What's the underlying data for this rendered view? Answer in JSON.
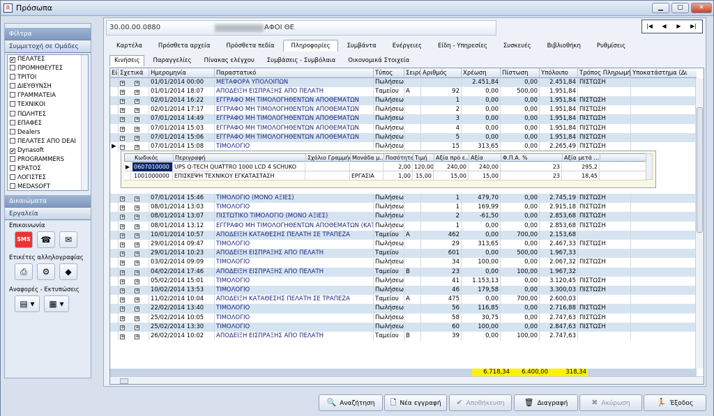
{
  "window": {
    "title": "Πρόσωπα",
    "icon": "app-icon"
  },
  "left": {
    "filters_label": "Φίλτρα",
    "groups_label": "Συμμετοχή σε Ομάδες",
    "groups": [
      {
        "label": "ΠΕΛΑΤΕΣ",
        "checked": true
      },
      {
        "label": "ΠΡΟΜΗΘΕΥΤΕΣ",
        "checked": false
      },
      {
        "label": "ΤΡΙΤΟΙ",
        "checked": false
      },
      {
        "label": "ΔΙΕΥΘΥΝΣΗ",
        "checked": false
      },
      {
        "label": "ΓΡΑΜΜΑΤΕΙΑ",
        "checked": false
      },
      {
        "label": "ΤΕΧΝΙΚΟΙ",
        "checked": false
      },
      {
        "label": "ΠΩΛΗΤΕΣ",
        "checked": false
      },
      {
        "label": "ΕΠΑΦΕΣ",
        "checked": false
      },
      {
        "label": "Dealers",
        "checked": false
      },
      {
        "label": "ΠΕΛΑΤΕΣ ΑΠΟ DEAI",
        "checked": false
      },
      {
        "label": "Dynasoft",
        "checked": true
      },
      {
        "label": "PROGRAMMERS",
        "checked": false
      },
      {
        "label": "ΚΡΑΤΟΣ",
        "checked": false
      },
      {
        "label": "ΛΟΓΙΣΤΕΣ",
        "checked": false
      },
      {
        "label": "MEDASOFT",
        "checked": false
      }
    ],
    "rights_label": "Δικαιώματα",
    "tools_label": "Εργαλεία",
    "comm_label": "Επικοινωνία",
    "labels_label": "Ετικέτες αλληλογραφίας",
    "reports_label": "Αναφορές - Εκτυπώσεις"
  },
  "top": {
    "code": "30.00.00.0880",
    "name": "ΑΦΟΙ ΘΕ"
  },
  "tabs": [
    "Καρτέλα",
    "Πρόσθετα αρχεία",
    "Πρόσθετα πεδία",
    "Πληροφορίες",
    "Συμβάντα",
    "Ενέργειες",
    "Είδη - Υπηρεσίες",
    "Συσκευές",
    "Βιβλιοθήκη",
    "Ρυθμίσεις"
  ],
  "subtabs": [
    "Κινήσεις",
    "Παραγγελίες",
    "Πίνακας ελέγχου",
    "Συμβάσεις - Συμβόλαια",
    "Οικονομικά Στοιχεία"
  ],
  "columns": [
    "Είδη",
    "Σχετικά",
    "Ημερομηνία",
    "Παραστατικό",
    "Τύπος",
    "Σειρά",
    "Αριθμός",
    "Χρέωση",
    "Πίστωση",
    "Υπόλοιπο",
    "Τρόπος Πληρωμής",
    "Υποκατάστημα (Δι"
  ],
  "rows_top": [
    [
      "01/01/2014 00:00",
      "ΜΕΤΑΦΟΡΑ ΥΠΟΛΟΙΠΩΝ",
      "Πωλήσεων",
      "",
      "",
      "2.451,84",
      "0,00",
      "2.451,84",
      "ΠΙΣΤΩΣΗ"
    ],
    [
      "01/01/2014 18:07",
      "ΑΠΟΔΕΙΞΗ ΕΙΣΠΡΑΞΗΣ ΑΠΟ ΠΕΛΑΤΗ",
      "Ταμείου",
      "Α",
      "92",
      "0,00",
      "500,00",
      "1.951,84",
      ""
    ],
    [
      "02/01/2014 16:22",
      "ΕΓΓΡΑΦΟ ΜΗ ΤΙΜΟΛΟΓΗΘΕΝΤΩΝ ΑΠΟΘΕΜΑΤΩΝ",
      "Πωλήσεων",
      "",
      "1",
      "0,00",
      "0,00",
      "1.951,84",
      "ΠΙΣΤΩΣΗ"
    ],
    [
      "02/01/2014 17:17",
      "ΕΓΓΡΑΦΟ ΜΗ ΤΙΜΟΛΟΓΗΘΕΝΤΩΝ ΑΠΟΘΕΜΑΤΩΝ",
      "Πωλήσεων",
      "",
      "2",
      "0,00",
      "0,00",
      "1.951,84",
      "ΠΙΣΤΩΣΗ"
    ],
    [
      "07/01/2014 14:49",
      "ΕΓΓΡΑΦΟ ΜΗ ΤΙΜΟΛΟΓΗΘΕΝΤΩΝ ΑΠΟΘΕΜΑΤΩΝ",
      "Πωλήσεων",
      "",
      "3",
      "0,00",
      "0,00",
      "1.951,84",
      "ΠΙΣΤΩΣΗ"
    ],
    [
      "07/01/2014 15:03",
      "ΕΓΓΡΑΦΟ ΜΗ ΤΙΜΟΛΟΓΗΘΕΝΤΩΝ ΑΠΟΘΕΜΑΤΩΝ",
      "Πωλήσεων",
      "",
      "4",
      "0,00",
      "0,00",
      "1.951,84",
      "ΠΙΣΤΩΣΗ"
    ],
    [
      "07/01/2014 15:06",
      "ΕΓΓΡΑΦΟ ΜΗ ΤΙΜΟΛΟΓΗΘΕΝΤΩΝ ΑΠΟΘΕΜΑΤΩΝ",
      "Πωλήσεων",
      "",
      "5",
      "0,00",
      "0,00",
      "1.951,84",
      "ΠΙΣΤΩΣΗ"
    ],
    [
      "07/01/2014 15:08",
      "ΤΙΜΟΛΟΓΙΟ",
      "Πωλήσεων",
      "",
      "15",
      "313,65",
      "0,00",
      "2.265,49",
      "ΠΙΣΤΩΣΗ"
    ]
  ],
  "detail": {
    "columns": [
      "Κωδικός",
      "Περιγραφή",
      "Σχόλιο Γραμμής",
      "Μονάδα μ...",
      "Ποσότητα",
      "Τιμή",
      "Αξία πρό ε...",
      "Αξία",
      "Φ.Π.Α. %",
      "Αξία μετά ..."
    ],
    "rows": [
      [
        "0607010000",
        "UPS Q-TECH QUATTRO 1000 LCD 4 SCHUKO",
        "",
        "",
        "2,00",
        "120,00",
        "240,00",
        "240,00",
        "23",
        "295,2"
      ],
      [
        "1001000000",
        "ΕΠΙΣΚΕΨΗ ΤΕΧΝΙΚΟΥ ΕΓΚΑΤΑΣΤΑΣΗ",
        "",
        "ΕΡΓΑΣΙΑ",
        "1,00",
        "15,00",
        "15,00",
        "15,00",
        "23",
        "18,45"
      ]
    ]
  },
  "rows_bottom": [
    [
      "07/01/2014 15:46",
      "ΤΙΜΟΛΟΓΙΟ (ΜΟΝΟ ΑΞΙΕΣ)",
      "Πωλήσεων",
      "",
      "1",
      "479,70",
      "0,00",
      "2.745,19",
      "ΠΙΣΤΩΣΗ"
    ],
    [
      "08/01/2014 13:03",
      "ΤΙΜΟΛΟΓΙΟ",
      "Πωλήσεων",
      "",
      "1",
      "169,99",
      "0,00",
      "2.915,18",
      "ΠΙΣΤΩΣΗ"
    ],
    [
      "08/01/2014 13:07",
      "ΠΙΣΤΩΤΙΚΟ ΤΙΜΟΛΟΓΙΟ (ΜΟΝΟ ΑΞΙΕΣ)",
      "Πωλήσεων",
      "",
      "2",
      "-61,50",
      "0,00",
      "2.853,68",
      "ΠΙΣΤΩΣΗ"
    ],
    [
      "08/01/2014 13:12",
      "ΕΓΓΡΑΦΟ ΜΗ ΤΙΜΟΛΟΓΗΘΕΝΤΩΝ ΑΠΟΘΕΜΑΤΩΝ (ΚΑΤΑ",
      "Πωλήσεων",
      "",
      "1",
      "0,00",
      "0,00",
      "2.853,68",
      "ΠΙΣΤΩΣΗ"
    ],
    [
      "10/01/2014 10:57",
      "ΑΠΟΔΕΙΞΗ ΚΑΤΑΘΕΣΗΣ ΠΕΛΑΤΗ ΣΕ ΤΡΑΠΕΖΑ",
      "Ταμείου",
      "Α",
      "462",
      "0,00",
      "700,00",
      "2.153,68",
      ""
    ],
    [
      "29/01/2014 09:47",
      "ΤΙΜΟΛΟΓΙΟ",
      "Πωλήσεων",
      "",
      "29",
      "313,65",
      "0,00",
      "2.467,33",
      "ΠΙΣΤΩΣΗ"
    ],
    [
      "29/01/2014 10:23",
      "ΑΠΟΔΕΙΞΗ ΕΙΣΠΡΑΞΗΣ ΑΠΟ ΠΕΛΑΤΗ",
      "Ταμείου",
      "",
      "601",
      "0,00",
      "500,00",
      "1.967,33",
      ""
    ],
    [
      "03/02/2014 09:09",
      "ΤΙΜΟΛΟΓΙΟ",
      "Πωλήσεων",
      "",
      "34",
      "100,00",
      "0,00",
      "2.067,32",
      "ΠΙΣΤΩΣΗ"
    ],
    [
      "04/02/2014 17:46",
      "ΑΠΟΔΕΙΞΗ ΕΙΣΠΡΑΞΗΣ ΑΠΟ ΠΕΛΑΤΗ",
      "Ταμείου",
      "Β",
      "23",
      "0,00",
      "100,00",
      "1.967,32",
      ""
    ],
    [
      "05/02/2014 15:01",
      "ΤΙΜΟΛΟΓΙΟ",
      "Πωλήσεων",
      "",
      "41",
      "1.153,13",
      "0,00",
      "3.120,45",
      "ΠΙΣΤΩΣΗ"
    ],
    [
      "10/02/2014 13:53",
      "ΤΙΜΟΛΟΓΙΟ",
      "Πωλήσεων",
      "",
      "46",
      "179,58",
      "0,00",
      "3.300,03",
      "ΠΙΣΤΩΣΗ"
    ],
    [
      "11/02/2014 10:04",
      "ΑΠΟΔΕΙΞΗ ΚΑΤΑΘΕΣΗΣ ΠΕΛΑΤΗ ΣΕ ΤΡΑΠΕΖΑ",
      "Ταμείου",
      "Α",
      "475",
      "0,00",
      "700,00",
      "2.600,03",
      ""
    ],
    [
      "22/02/2014 13:40",
      "ΤΙΜΟΛΟΓΙΟ",
      "Πωλήσεων",
      "",
      "56",
      "116,85",
      "0,00",
      "2.716,88",
      "ΠΙΣΤΩΣΗ"
    ],
    [
      "25/02/2014 10:05",
      "ΤΙΜΟΛΟΓΙΟ",
      "Πωλήσεων",
      "",
      "58",
      "30,75",
      "0,00",
      "2.747,63",
      "ΠΙΣΤΩΣΗ"
    ],
    [
      "25/02/2014 13:30",
      "ΤΙΜΟΛΟΓΙΟ",
      "Πωλήσεων",
      "",
      "60",
      "100,00",
      "0,00",
      "2.847,63",
      "ΠΙΣΤΩΣΗ"
    ],
    [
      "26/02/2014 10:02",
      "ΑΠΟΔΕΙΞΗ ΕΙΣΠΡΑΞΗΣ ΑΠΟ ΠΕΛΑΤΗ",
      "Ταμείου",
      "Β",
      "39",
      "0,00",
      "100,00",
      "2.747,63",
      ""
    ]
  ],
  "totals": {
    "debit": "6.718,34",
    "credit": "6.400,00",
    "balance": "318,34"
  },
  "buttons": {
    "search": "Αναζήτηση",
    "new": "Νέα εγγραφή",
    "save": "Αποθήκευση",
    "delete": "Διαγραφή",
    "cancel": "Ακύρωση",
    "exit": "Έξοδος"
  }
}
